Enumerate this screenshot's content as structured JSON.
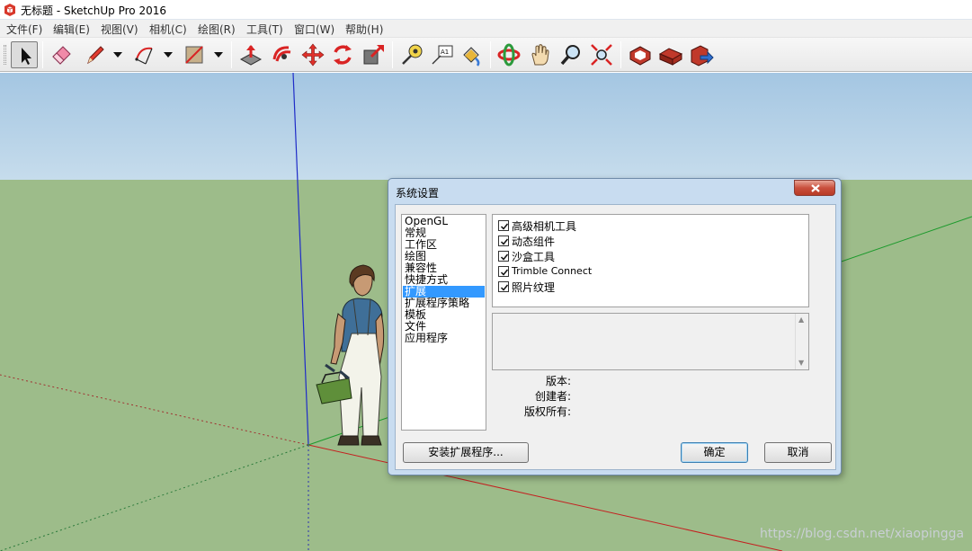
{
  "window": {
    "title": "无标题 - SketchUp Pro 2016"
  },
  "menu": [
    "文件(F)",
    "编辑(E)",
    "视图(V)",
    "相机(C)",
    "绘图(R)",
    "工具(T)",
    "窗口(W)",
    "帮助(H)"
  ],
  "toolbar": {
    "tools": [
      "select-tool",
      "eraser-tool",
      "pencil-line-tool",
      "arc-tool",
      "rectangle-tool",
      "push-pull-tool",
      "follow-me-tool",
      "move-tool",
      "rotate-tool",
      "scale-tool",
      "tape-measure-tool",
      "text-tool",
      "paint-bucket-tool",
      "orbit-tool",
      "pan-tool",
      "zoom-tool",
      "zoom-extents-tool",
      "3d-warehouse-tool",
      "extension-warehouse-tool",
      "share-model-tool"
    ]
  },
  "colors": {
    "sky": "#a9cbe5",
    "ground": "#9dbc8a",
    "dialog_frame": "#c8dcf0",
    "selection": "#3399ff",
    "close_button": "#c9503d",
    "arrow": "#e8372c"
  },
  "dialog": {
    "title": "系统设置",
    "nav_items": [
      {
        "label": "OpenGL",
        "selected": false
      },
      {
        "label": "常规",
        "selected": false
      },
      {
        "label": "工作区",
        "selected": false
      },
      {
        "label": "绘图",
        "selected": false
      },
      {
        "label": "兼容性",
        "selected": false
      },
      {
        "label": "快捷方式",
        "selected": false
      },
      {
        "label": "扩展",
        "selected": true
      },
      {
        "label": "扩展程序策略",
        "selected": false
      },
      {
        "label": "模板",
        "selected": false
      },
      {
        "label": "文件",
        "selected": false
      },
      {
        "label": "应用程序",
        "selected": false
      }
    ],
    "extensions": [
      {
        "label": "高级相机工具",
        "checked": true
      },
      {
        "label": "动态组件",
        "checked": true
      },
      {
        "label": "沙盒工具",
        "checked": true
      },
      {
        "label": "Trimble Connect",
        "checked": true
      },
      {
        "label": "照片纹理",
        "checked": true
      }
    ],
    "info": {
      "version_label": "版本:",
      "creator_label": "创建者:",
      "copyright_label": "版权所有:"
    },
    "install_button": "安装扩展程序...",
    "ok_button": "确定",
    "cancel_button": "取消"
  },
  "watermark": "https://blog.csdn.net/xiaopingga"
}
